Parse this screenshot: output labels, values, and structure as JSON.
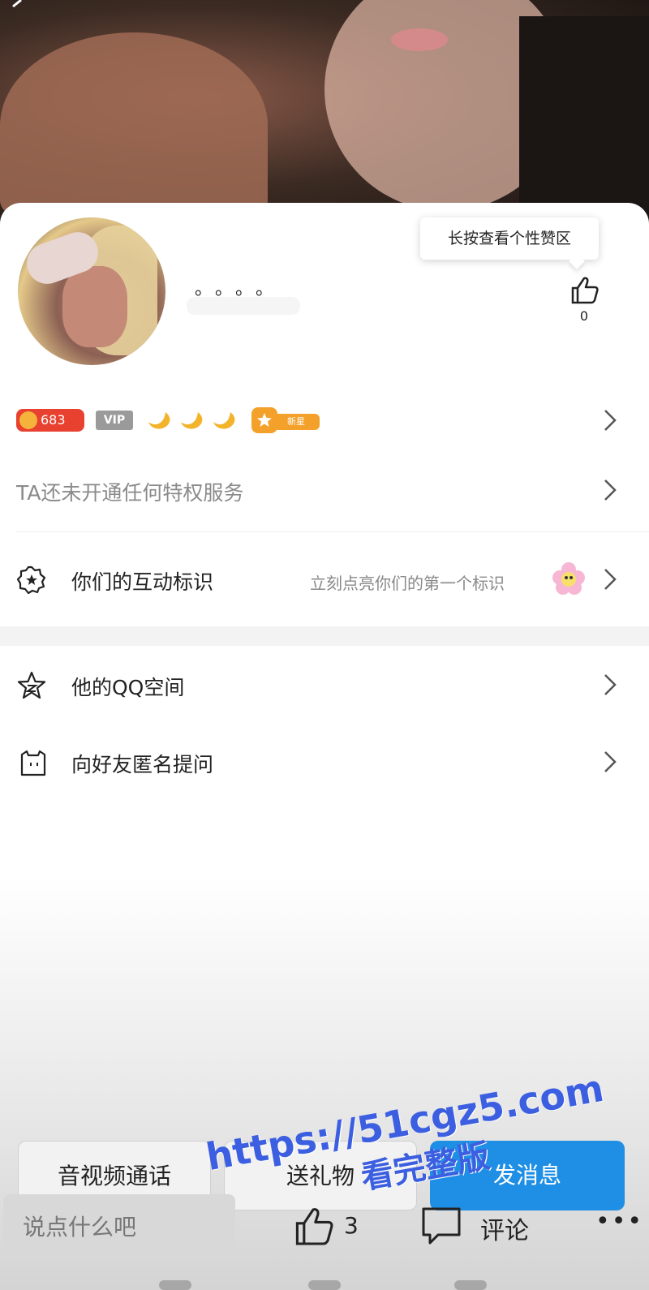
{
  "header": {
    "back_icon": "back-arrow-icon"
  },
  "profile": {
    "nickname": "。。。。",
    "tooltip": "长按查看个性赞区",
    "like_count": "0"
  },
  "badges": {
    "level": "683",
    "vip": "VIP",
    "star_tag": "新星"
  },
  "rows": {
    "privilege_text": "TA还未开通任何特权服务",
    "interaction_label": "你们的互动标识",
    "interaction_hint": "立刻点亮你们的第一个标识",
    "qzone_label": "他的QQ空间",
    "anonymous_label": "向好友匿名提问"
  },
  "actions": {
    "call_label": "音视频通话",
    "gift_label": "送礼物",
    "message_label": "发消息"
  },
  "bottom_bar": {
    "input_placeholder": "说点什么吧",
    "like_count": "3",
    "comment_label": "评论",
    "more_label": "•••"
  },
  "watermark": {
    "line1": "https://51cgz5.com",
    "line2": "看完整版"
  },
  "colors": {
    "primary": "#1f8fe5",
    "level_badge": "#e8412f",
    "star_badge": "#f3a12a",
    "watermark": "#3b5fe0"
  }
}
